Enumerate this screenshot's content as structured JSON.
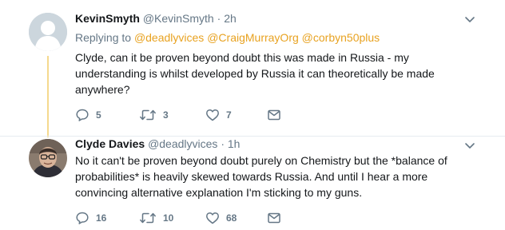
{
  "tweets": [
    {
      "name": "KevinSmyth",
      "handle": "@KevinSmyth",
      "separator": "·",
      "time": "2h",
      "replying_prefix": "Replying to",
      "mentions": [
        "@deadlyvices",
        "@CraigMurrayOrg",
        "@corbyn50plus"
      ],
      "text_lines": [
        "Clyde, can it be proven beyond doubt this was made in Russia - my",
        "understanding is whilst developed by Russia it can theoretically be made",
        "anywhere?"
      ],
      "actions": {
        "replies": "5",
        "retweets": "3",
        "likes": "7"
      }
    },
    {
      "name": "Clyde Davies",
      "handle": "@deadlyvices",
      "separator": "·",
      "time": "1h",
      "text_lines": [
        "No it can't be proven beyond doubt purely on Chemistry but the *balance of",
        "probabilities* is heavily skewed towards Russia. And until I hear a more",
        "convincing alternative explanation I'm sticking to my guns."
      ],
      "actions": {
        "replies": "16",
        "retweets": "10",
        "likes": "68"
      }
    }
  ],
  "colors": {
    "mention": "#e8a220",
    "thread_line": "#f5d98e",
    "icon": "#657786"
  },
  "icons": {
    "reply": "reply-icon",
    "retweet": "retweet-icon",
    "like": "heart-icon",
    "dm": "envelope-icon",
    "more": "chevron-down-icon"
  }
}
